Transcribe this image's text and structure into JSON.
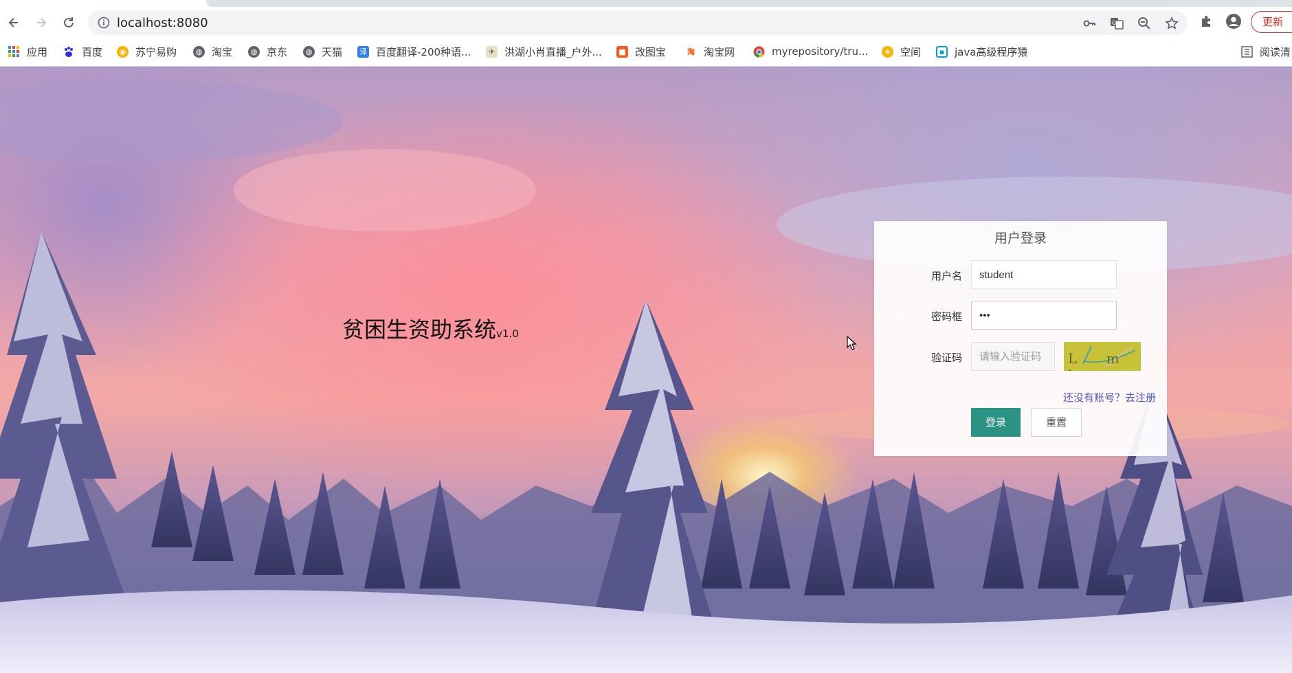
{
  "browser": {
    "url": "localhost:8080",
    "update_label": "更新",
    "bookmarks": [
      {
        "label": "应用",
        "icon": "apps-grid-icon"
      },
      {
        "label": "百度",
        "icon": "baidu-paw-icon"
      },
      {
        "label": "苏宁易购",
        "icon": "suning-icon"
      },
      {
        "label": "淘宝",
        "icon": "globe-icon"
      },
      {
        "label": "京东",
        "icon": "globe-icon"
      },
      {
        "label": "天猫",
        "icon": "globe-icon"
      },
      {
        "label": "百度翻译-200种语...",
        "icon": "baidu-translate-icon"
      },
      {
        "label": "洪湖小肖直播_户外...",
        "icon": "bird-icon"
      },
      {
        "label": "改图宝",
        "icon": "gaitubao-icon"
      },
      {
        "label": "淘宝网",
        "icon": "taobao-icon"
      },
      {
        "label": "myrepository/tru...",
        "icon": "chrome-icon"
      },
      {
        "label": "空间",
        "icon": "qzone-icon"
      },
      {
        "label": "java高级程序猿",
        "icon": "bilibili-icon"
      }
    ],
    "reading_mode_label": "阅读清"
  },
  "page": {
    "system_title": "贫困生资助系统",
    "system_version": "v1.0",
    "login": {
      "title": "用户登录",
      "username_label": "用户名",
      "username_value": "student",
      "password_label": "密码框",
      "password_value": "•••",
      "captcha_label": "验证码",
      "captcha_placeholder": "请输入验证码",
      "captcha_text": "L m h",
      "register_link": "还没有账号？去注册",
      "login_button": "登录",
      "reset_button": "重置"
    }
  },
  "colors": {
    "login_button": "#2a9384",
    "register_link": "#4d55c8",
    "update_button": "#d93025"
  }
}
